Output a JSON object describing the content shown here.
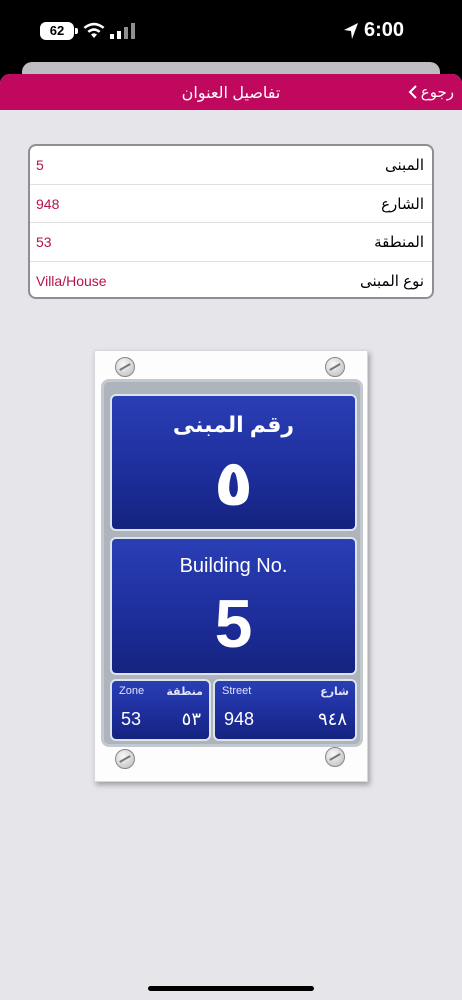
{
  "status_bar": {
    "battery": "62",
    "time": "6:00",
    "icons": [
      "wifi-icon",
      "cellular-signal-icon",
      "location-arrow-icon"
    ]
  },
  "nav": {
    "title": "تفاصيل العنوان",
    "back_label": "رجوع"
  },
  "details": [
    {
      "label": "المبنى",
      "value": "5"
    },
    {
      "label": "الشارع",
      "value": "948"
    },
    {
      "label": "المنطقة",
      "value": "53"
    },
    {
      "label": "نوع المبنى",
      "value": "Villa/House"
    }
  ],
  "plate": {
    "arabic_caption": "رقم المبنى",
    "arabic_number": "٥",
    "english_caption": "Building No.",
    "english_number": "5",
    "zone_label_en": "Zone",
    "zone_label_ar": "منطقة",
    "zone_en": "53",
    "zone_ar": "٥٣",
    "street_label_en": "Street",
    "street_label_ar": "شارع",
    "street_en": "948",
    "street_ar": "٩٤٨"
  },
  "colors": {
    "nav_bg": "#c0095e",
    "value_text": "#b5124f",
    "plate_blue": "#1d2d9a"
  }
}
